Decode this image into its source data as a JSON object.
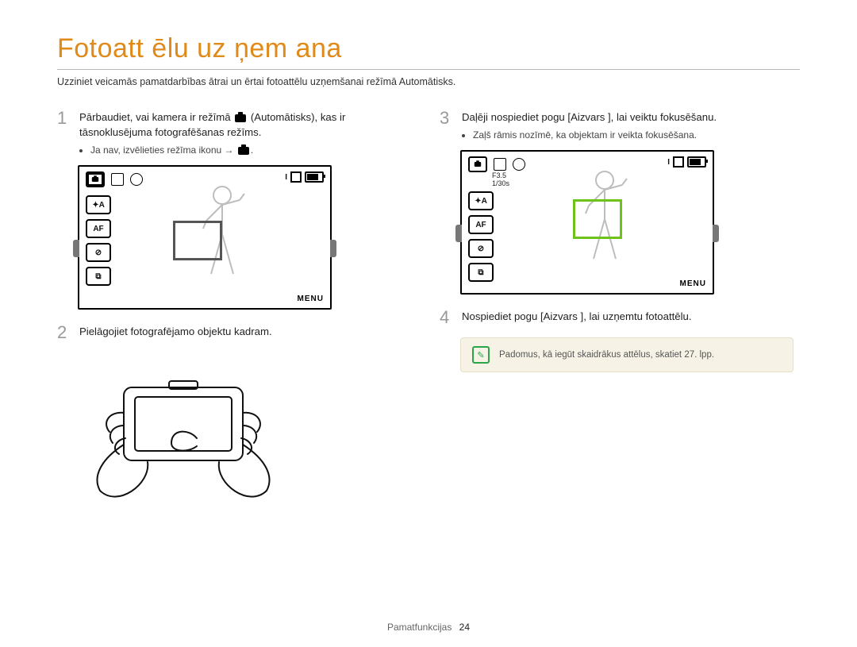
{
  "title": "Fotoatt ēlu uz ņem ana",
  "intro": "Uzziniet veicamās pamatdarbības ātrai un ērtai fotoattēlu uzņemšanai režīmā Automātisks.",
  "steps": {
    "s1": {
      "num": "1",
      "text_a": "Pārbaudiet, vai kamera ir režīmā ",
      "text_b": " (Automātisks), kas ir tāsnoklusējuma fotografēšanas režīms.",
      "bullet": "Ja nav, izvēlieties režīma ikonu → "
    },
    "s2": {
      "num": "2",
      "text": "Pielāgojiet fotografējamo objektu kadram."
    },
    "s3": {
      "num": "3",
      "text": "Daļēji nospiediet pogu [Aizvars ], lai veiktu fokusēšanu.",
      "bullet": "Zaļš rāmis nozīmē, ka objektam ir veikta fokusēšana."
    },
    "s4": {
      "num": "4",
      "text": "Nospiediet pogu [Aizvars ], lai uzņemtu fotoattēlu."
    }
  },
  "lcd": {
    "exposure": "F3.5",
    "shutter": "1/30s",
    "side_labels": [
      "✦A",
      "AF",
      "⊘",
      "⧉"
    ],
    "menu": "MENU"
  },
  "note": "Padomus, kā iegūt skaidrākus attēlus, skatiet 27. lpp.",
  "footer": {
    "section": "Pamatfunkcijas",
    "page": "24"
  }
}
